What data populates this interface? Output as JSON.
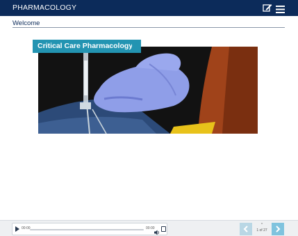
{
  "header": {
    "title": "PHARMACOLOGY",
    "notes_icon": "edit-notes-icon",
    "menu_icon": "hamburger-menu-icon"
  },
  "page": {
    "heading": "Welcome"
  },
  "hero": {
    "banner_text": "Critical Care Pharmacology",
    "banner_color": "#2394b2"
  },
  "player": {
    "current_time": "00:00",
    "duration": "00:00",
    "progress": 0,
    "play_icon": "play-icon",
    "volume_icon": "volume-icon",
    "captions_icon": "captions-icon"
  },
  "pagination": {
    "current": "1 of 27",
    "up_label": "^",
    "prev_icon": "chevron-left-icon",
    "next_icon": "chevron-right-icon"
  },
  "colors": {
    "header_bg": "#0c2b5a",
    "accent": "#2394b2",
    "next_button": "#7fc3de",
    "prev_button": "#b9d7e5"
  }
}
